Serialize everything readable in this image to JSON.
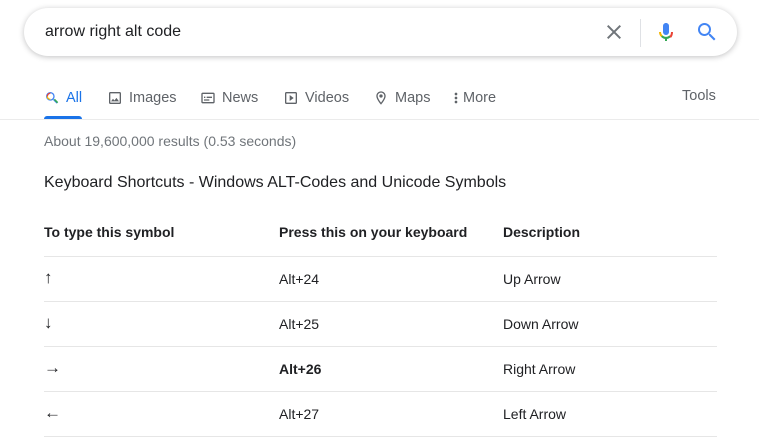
{
  "search": {
    "query": "arrow right alt code"
  },
  "icons": {
    "clear": "close-icon",
    "mic": "microphone-icon",
    "search": "search-icon"
  },
  "colors": {
    "accent": "#1a73e8",
    "text": "#202124",
    "muted": "#70757a",
    "tab": "#5f6368"
  },
  "tabs": [
    {
      "label": "All",
      "icon": "search-icon",
      "active": true
    },
    {
      "label": "Images",
      "icon": "image-icon"
    },
    {
      "label": "News",
      "icon": "news-icon"
    },
    {
      "label": "Videos",
      "icon": "video-icon"
    },
    {
      "label": "Maps",
      "icon": "map-pin-icon"
    },
    {
      "label": "More",
      "icon": "more-vertical-icon"
    }
  ],
  "tools_label": "Tools",
  "result_stats": "About 19,600,000 results (0.53 seconds)",
  "result_title": "Keyboard Shortcuts - Windows ALT-Codes and Unicode Symbols",
  "table": {
    "headers": [
      "To type this symbol",
      "Press this on your keyboard",
      "Description"
    ],
    "rows": [
      {
        "symbol": "↑",
        "keys": "Alt+24",
        "description": "Up Arrow",
        "highlight": false
      },
      {
        "symbol": "↓",
        "keys": "Alt+25",
        "description": "Down Arrow",
        "highlight": false
      },
      {
        "symbol": "→",
        "keys": "Alt+26",
        "description": "Right Arrow",
        "highlight": true
      },
      {
        "symbol": "←",
        "keys": "Alt+27",
        "description": "Left Arrow",
        "highlight": false
      }
    ]
  }
}
